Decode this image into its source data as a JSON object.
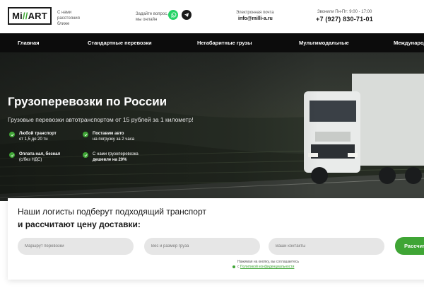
{
  "header": {
    "logo_prefix": "Mi",
    "logo_accent": "//",
    "logo_rest": "ART",
    "tagline": "С нами расстояния ближе",
    "question_text": "Задайте вопрос, мы онлайн",
    "email_label": "Электронная почта",
    "email": "info@milli-a.ru",
    "hours": "Звонили Пн-Пт: 9:00 - 17:00",
    "phone": "+7 (927) 830-71-01"
  },
  "nav": {
    "items": [
      "Главная",
      "Стандартные перевозки",
      "Негабаритные грузы",
      "Мультимодальные",
      "Международ"
    ]
  },
  "hero": {
    "title": "Грузоперевозки по России",
    "subtitle": "Грузовые перевозки автотранспортом от 15 рублей за 1 километр!",
    "features": [
      {
        "bold": "Любой транспорт",
        "normal": "от 1,5 до 20 тн"
      },
      {
        "bold": "Поставим авто",
        "normal": "на погрузку за 2 часа"
      },
      {
        "bold": "Оплата нал, безнал",
        "normal": "(с/без НДС)"
      },
      {
        "normal": "С нами грузоперевозка",
        "bold": "дешевле на 20%"
      }
    ]
  },
  "form": {
    "line1": "Наши логисты подберут подходящий транспорт",
    "line2": "и рассчитают цену доставки:",
    "route_placeholder": "Маршрут перевозки",
    "weight_placeholder": "Вес и размер груза",
    "contacts_placeholder": "Ваши контакты",
    "submit_label": "Рассчитать",
    "consent_text": "Нажимая на кнопку, вы соглашаетесь",
    "consent_prefix": "с",
    "consent_link": "Политикой конфиденциальности"
  },
  "colors": {
    "accent": "#3fa535",
    "nav_bg": "#0c0c0c",
    "whatsapp": "#25d366"
  }
}
